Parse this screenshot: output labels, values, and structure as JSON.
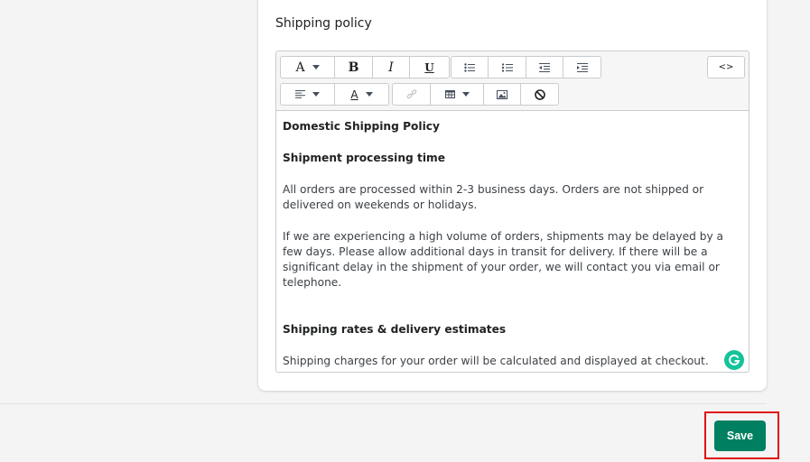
{
  "card": {
    "title": "Shipping policy"
  },
  "toolbar": {
    "font_label": "A",
    "bold_label": "B",
    "italic_label": "I",
    "underline_label": "U",
    "source_label": "<>",
    "text_color_label": "A"
  },
  "editor": {
    "heading1": "Domestic Shipping Policy",
    "heading2": "Shipment processing time",
    "para1": "All orders are processed within 2-3 business days. Orders are not shipped or delivered on weekends or holidays.",
    "para2": "If we are experiencing a high volume of orders, shipments may be delayed by a few days. Please allow additional days in transit for delivery. If there will be a significant delay in the shipment of your order, we will contact you via email or telephone.",
    "heading3": "Shipping rates & delivery estimates",
    "para3": "Shipping charges for your order will be calculated and displayed at checkout."
  },
  "actions": {
    "save_label": "Save"
  },
  "colors": {
    "primary": "#008060",
    "highlight": "#e01010",
    "grammarly": "#15c39a"
  }
}
